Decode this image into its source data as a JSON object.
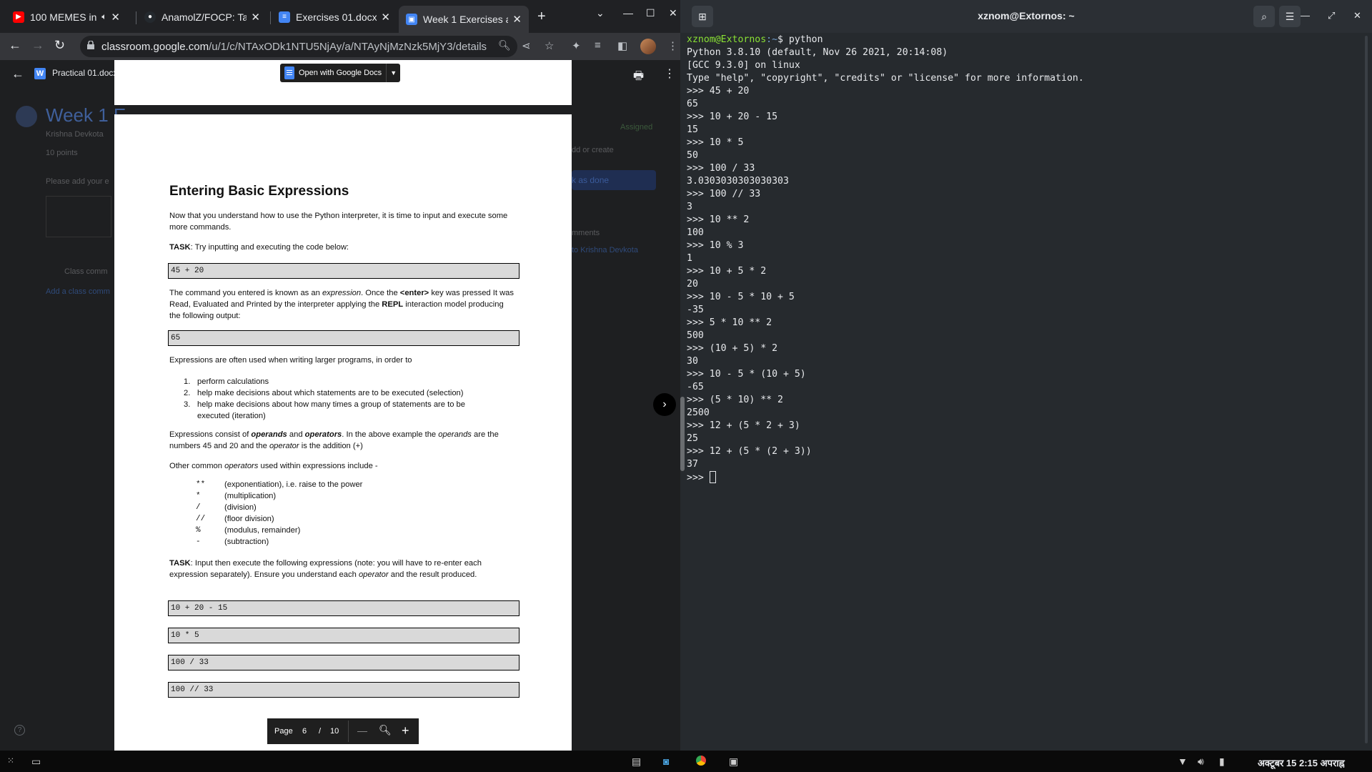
{
  "browser": {
    "tabs": [
      {
        "title": "100 MEMES in",
        "favicon": "youtube-icon",
        "color": "#ff0000"
      },
      {
        "title": "AnamolZ/FOCP: Ta",
        "favicon": "github-icon",
        "color": "#ffffff"
      },
      {
        "title": "Exercises 01.docx",
        "favicon": "docs-icon",
        "color": "#4285f4"
      },
      {
        "title": "Week 1 Exercises a",
        "favicon": "classroom-icon",
        "color": "#4285f4"
      }
    ],
    "url_host": "classroom.google.com",
    "url_path": "/u/1/c/NTAxODk1NTU5NjAy/a/NTAyNjMzNzk5MjY3/details"
  },
  "classroom": {
    "title": "Week 1 E",
    "author": "Krishna Devkota",
    "points": "10 points",
    "note": "Please add your e",
    "status": "Assigned",
    "add_create": "dd or create",
    "mark_done": "k as done",
    "comments": "mments",
    "to_name": "to Krishna Devkota",
    "class_comments": "Class comm",
    "add_comment": "Add a class comm"
  },
  "viewer": {
    "file_name": "Practical 01.docx",
    "open_button": "Open with Google Docs",
    "page_label": "Page",
    "page_current": "6",
    "page_sep": "/",
    "page_total": "10"
  },
  "doc": {
    "heading": "Entering Basic Expressions",
    "intro": "Now that you understand how to use the Python interpreter, it is time to input and execute some more commands.",
    "task1_label": "TASK",
    "task1_text": ": Try inputting and executing the code below:",
    "code1": "45 + 20",
    "p2_a": "The command you entered is known as an ",
    "p2_expression": "expression",
    "p2_b": ".  Once the ",
    "p2_enter": "<enter>",
    "p2_c": " key was pressed It was Read, Evaluated and Printed by the interpreter applying the ",
    "p2_repl": "REPL",
    "p2_d": " interaction model producing the following output:",
    "code2": "65",
    "p3": "Expressions are often used when writing larger programs, in order to",
    "list": [
      {
        "num": "1.",
        "text": "perform calculations"
      },
      {
        "num": "2.",
        "text": "help make decisions about which statements are to be executed (selection)"
      },
      {
        "num": "3.",
        "text": "help make decisions about how many times a group of statements are to be"
      }
    ],
    "list3_cont": "executed (iteration)",
    "p4_a": "Expressions consist of ",
    "p4_operands": "operands",
    "p4_and": " and ",
    "p4_operators": "operators",
    "p4_b": ". In the above example the ",
    "p4_operands2": "operands",
    "p4_c": " are the numbers 45 and 20 and the ",
    "p4_operator": "operator",
    "p4_d": " is the addition (+)",
    "p5_a": "Other common ",
    "p5_operators": "operators",
    "p5_b": " used within expressions include -",
    "ops": [
      {
        "sym": "**",
        "desc": "(exponentiation), i.e. raise to the power"
      },
      {
        "sym": "*",
        "desc": "(multiplication)"
      },
      {
        "sym": "/",
        "desc": "(division)"
      },
      {
        "sym": "//",
        "desc": "(floor division)"
      },
      {
        "sym": "%",
        "desc": "(modulus, remainder)"
      },
      {
        "sym": "-",
        "desc": "(subtraction)"
      }
    ],
    "task2_label": "TASK",
    "task2_a": ": Input then execute the following expressions (note: you will have to re-enter each expression separately). Ensure you understand each ",
    "task2_operator": "operator",
    "task2_b": " and the result produced.",
    "exprs": [
      "10 + 20 - 15",
      "10 * 5",
      "100 / 33",
      "100 // 33"
    ]
  },
  "terminal": {
    "title": "xznom@Extornos: ~",
    "prompt_user": "xznom@Extornos",
    "prompt_path": ":~",
    "prompt_cmd": "$ python",
    "lines": [
      "Python 3.8.10 (default, Nov 26 2021, 20:14:08)",
      "[GCC 9.3.0] on linux",
      "Type \"help\", \"copyright\", \"credits\" or \"license\" for more information.",
      ">>> 45 + 20",
      "65",
      ">>> 10 + 20 - 15",
      "15",
      ">>> 10 * 5",
      "50",
      ">>> 100 / 33",
      "3.0303030303030303",
      ">>> 100 // 33",
      "3",
      ">>> 10 ** 2",
      "100",
      ">>> 10 % 3",
      "1",
      ">>> 10 + 5 * 2",
      "20",
      ">>> 10 - 5 * 10 + 5",
      "-35",
      ">>> 5 * 10 ** 2",
      "500",
      ">>> (10 + 5) * 2",
      "30",
      ">>> 10 - 5 * (10 + 5)",
      "-65",
      ">>> (5 * 10) ** 2",
      "2500",
      ">>> 12 + (5 * 2 + 3)",
      "25",
      ">>> 12 + (5 * (2 + 3))",
      "37"
    ],
    "last_prompt": ">>> "
  },
  "taskbar": {
    "clock": "अक्टूबर 15   2:15 अपराह्न"
  }
}
